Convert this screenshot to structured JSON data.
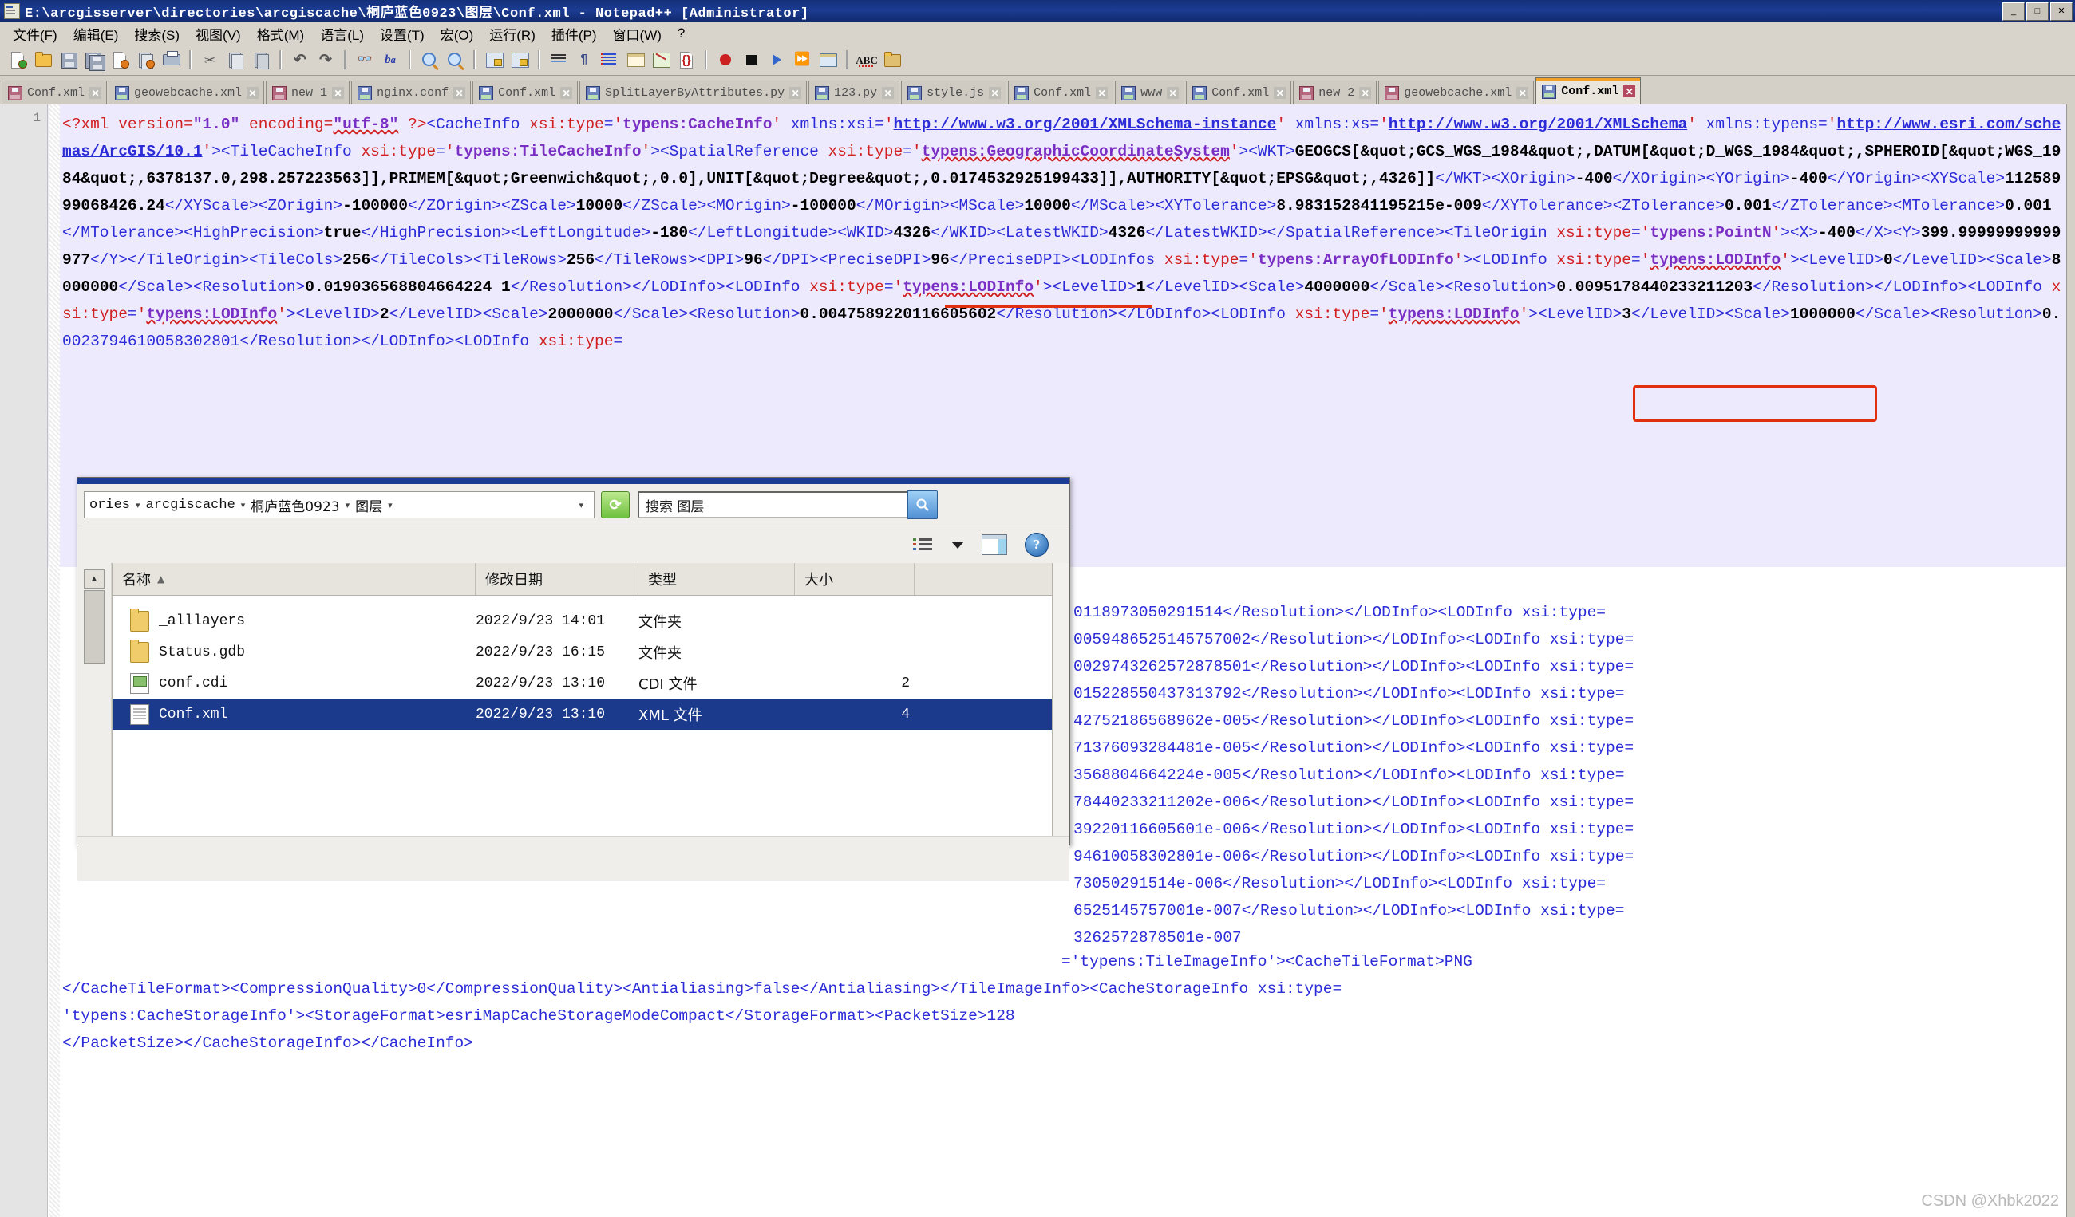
{
  "window": {
    "title": "E:\\arcgisserver\\directories\\arcgiscache\\桐庐蓝色0923\\图层\\Conf.xml - Notepad++ [Administrator]",
    "minimize_label": "_",
    "maximize_label": "□",
    "close_label": "✕"
  },
  "menu": {
    "items": [
      {
        "label": "文件(F)"
      },
      {
        "label": "编辑(E)"
      },
      {
        "label": "搜索(S)"
      },
      {
        "label": "视图(V)"
      },
      {
        "label": "格式(M)"
      },
      {
        "label": "语言(L)"
      },
      {
        "label": "设置(T)"
      },
      {
        "label": "宏(O)"
      },
      {
        "label": "运行(R)"
      },
      {
        "label": "插件(P)"
      },
      {
        "label": "窗口(W)"
      },
      {
        "label": "?"
      }
    ]
  },
  "toolbar": {
    "icons": [
      "new-file-icon",
      "open-file-icon",
      "save-icon",
      "save-all-icon",
      "close-file-icon",
      "close-all-icon",
      "print-icon",
      "cut-icon",
      "copy-icon",
      "paste-icon",
      "undo-icon",
      "redo-icon",
      "find-icon",
      "replace-icon",
      "zoom-in-icon",
      "zoom-out-icon",
      "sync-vertical-icon",
      "sync-horizontal-icon",
      "word-wrap-icon",
      "show-all-chars-icon",
      "indent-guide-icon",
      "ui-display-icon",
      "document-map-icon",
      "function-list-icon",
      "record-macro-icon",
      "stop-macro-icon",
      "play-macro-icon",
      "fast-play-macro-icon",
      "save-macro-icon",
      "spell-check-icon",
      "folder-workspace-icon"
    ]
  },
  "tabs": {
    "items": [
      {
        "label": "Conf.xml",
        "color": "red",
        "active": false
      },
      {
        "label": "geowebcache.xml",
        "color": "blue",
        "active": false
      },
      {
        "label": "new  1",
        "color": "red",
        "active": false
      },
      {
        "label": "nginx.conf",
        "color": "blue",
        "active": false
      },
      {
        "label": "Conf.xml",
        "color": "blue",
        "active": false
      },
      {
        "label": "SplitLayerByAttributes.py",
        "color": "blue",
        "active": false
      },
      {
        "label": "123.py",
        "color": "blue",
        "active": false
      },
      {
        "label": "style.js",
        "color": "blue",
        "active": false
      },
      {
        "label": "Conf.xml",
        "color": "blue",
        "active": false
      },
      {
        "label": "www",
        "color": "blue",
        "active": false
      },
      {
        "label": "Conf.xml",
        "color": "blue",
        "active": false
      },
      {
        "label": "new  2",
        "color": "red",
        "active": false
      },
      {
        "label": "geowebcache.xml",
        "color": "red",
        "active": false
      },
      {
        "label": "Conf.xml",
        "color": "blue",
        "active": true
      }
    ],
    "close_glyph": "✕"
  },
  "editor": {
    "line_number": "1",
    "xml_lines": [
      "<?xml version=\"1.0\" encoding=\"utf-8\" ?><CacheInfo xsi:type='typens:CacheInfo' xmlns:xsi='http://www.w3.org/2001/XMLSchema-instance' xmlns:xs='http://www.w3.org/2001/XMLSchema' xmlns:typens='http://www.esri.com/schemas/ArcGIS/10.1'><TileCacheInfo xsi:type='typens:TileCacheInfo'><SpatialReference xsi:type='typens:GeographicCoordinateSystem'><WKT>GEOGCS[&quot;GCS_WGS_1984&quot;,DATUM[&quot;D_WGS_1984&quot;,SPHEROID[&quot;WGS_1984&quot;,6378137.0,298.257223563]],PRIMEM[&quot;Greenwich&quot;,0.0],UNIT[&quot;Degree&quot;,0.0174532925199433]],AUTHORITY[&quot;EPSG&quot;,4326]]</WKT><XOrigin>-400</XOrigin><YOrigin>-400</YOrigin><XYScale>11258999068426.24</XYScale><ZOrigin>-100000</ZOrigin><ZScale>10000</ZScale><MOrigin>-100000</MOrigin><MScale>10000</MScale><XYTolerance>8.983152841195215e-009</XYTolerance><ZTolerance>0.001</ZTolerance><MTolerance>0.001</MTolerance><HighPrecision>true</HighPrecision><LeftLongitude>-180</LeftLongitude><WKID>4326</WKID><LatestWKID>4326</LatestWKID></SpatialReference><TileOrigin xsi:type='typens:PointN'><X>-400</X><Y>399.99999999999977</Y></TileOrigin><TileCols>256</TileCols><TileRows>256</TileRows><DPI>96</DPI><PreciseDPI>96</PreciseDPI><LODInfos xsi:type='typens:ArrayOfLODInfo'>"
    ],
    "visible_text_blocks": [
      "<?xml version=\"1.0\" encoding=\"utf-8\" ?><CacheInfo xsi:type='typens:CacheInfo' xmlns:xsi='http://www.w3.org/2001/XMLSchema-instance' xmlns:xs='",
      "http://www.w3.org/2001/XMLSchema' xmlns:typens='http://www.esri.com/schemas/ArcGIS/10.1'><TileCacheInfo xsi:type='typens:TileCacheInfo'",
      "><SpatialReference xsi:type='typens:GeographicCoordinateSystem'><WKT>GEOGCS[&quot;GCS_WGS_1984&quot;,DATUM[&quot;D_WGS_1984&quot;,SPHEROID[",
      "&quot;WGS_1984&quot;,6378137.0,298.257223563]],PRIMEM[&quot;Greenwich&quot;,0.0],UNIT[&quot;Degree&quot;,0.0174532925199433]],AUTHORITY[&quot;",
      "EPSG&quot;,4326]]</WKT><XOrigin>-400</XOrigin><YOrigin>-400</YOrigin><XYScale>11258999068426.24</XYScale><ZOrigin>-100000</ZOrigin><ZScale>10000",
      "</ZScale><MOrigin>-100000</MOrigin><MScale>10000</MScale><XYTolerance>8.983152841195215e-009</XYTolerance><ZTolerance>0.001",
      "</ZTolerance><MTolerance>0.001</MTolerance><HighPrecision>true</HighPrecision><LeftLongitude>-180</LeftLongitude><WKID>4326</WKID><LatestWKID>",
      "4326</LatestWKID></SpatialReference><TileOrigin xsi:type='typens:PointN'><X>-400</X><Y>399.99999999999977</Y></TileOrigin><TileCols>256",
      "</TileCols><TileRows>256</TileRows><DPI>96</DPI><PreciseDPI>96</PreciseDPI><LODInfos xsi:type='typens:ArrayOfLODInfo'><LODInfo xsi:type=",
      "'typens:LODInfo'><LevelID>0</LevelID><Scale>8000000</Scale><Resolution>0.019036568804664224 1</Resolution></LODInfo><LODInfo xsi:type=",
      "'typens:LODInfo'><LevelID>1</LevelID><Scale>4000000</Scale><Resolution>0.0095178440233211203</Resolution></LODInfo><LODInfo xsi:type=",
      "'typens:LODInfo'><LevelID>2</LevelID><Scale>2000000</Scale><Resolution>0.0047589220116605602</Resolution></LODInfo><LODInfo xsi:type=",
      "'typens:LODInfo'><LevelID>3</LevelID><Scale>1000000</Scale><Resolution>0.0023794610058302801</Resolution></LODInfo><LODInfo xsi:type="
    ],
    "right_fragments": [
      "0118973050291514</Resolution></LODInfo><LODInfo xsi:type=",
      "0059486525145757002</Resolution></LODInfo><LODInfo xsi:type=",
      "0029743262572878501</Resolution></LODInfo><LODInfo xsi:type=",
      "015228550437313792</Resolution></LODInfo><LODInfo xsi:type=",
      "42752186568962e-005</Resolution></LODInfo><LODInfo xsi:type=",
      "71376093284481e-005</Resolution></LODInfo><LODInfo xsi:type=",
      "3568804664224e-005</Resolution></LODInfo><LODInfo xsi:type=",
      "78440233211202e-006</Resolution></LODInfo><LODInfo xsi:type=",
      "39220116605601e-006</Resolution></LODInfo><LODInfo xsi:type=",
      "94610058302801e-006</Resolution></LODInfo><LODInfo xsi:type=",
      "73050291514e-006</Resolution></LODInfo><LODInfo xsi:type=",
      "6525145757001e-007</Resolution></LODInfo><LODInfo xsi:type=",
      "3262572878501e-007"
    ],
    "tail_lines": [
      "='typens:TileImageInfo'><CacheTileFormat>PNG",
      "</CacheTileFormat><CompressionQuality>0</CompressionQuality><Antialiasing>false</Antialiasing></TileImageInfo><CacheStorageInfo xsi:type=",
      "'typens:CacheStorageInfo'><StorageFormat>esriMapCacheStorageModeCompact</StorageFormat><PacketSize>128",
      "</PacketSize></CacheStorageInfo></CacheInfo>"
    ],
    "annotations": [
      {
        "name": "wkid-highlight-box",
        "text": "<WKID>4326</WKID>"
      },
      {
        "name": "gcs-wgs-1984-underline",
        "text": "GCS_WGS_1984"
      }
    ]
  },
  "file_dialog": {
    "breadcrumb": [
      {
        "label": "ories"
      },
      {
        "label": "arcgiscache"
      },
      {
        "label": "桐庐蓝色0923"
      },
      {
        "label": "图层"
      }
    ],
    "breadcrumb_separator": "▾",
    "dropdown_glyph": "▾",
    "refresh_label": "⟳",
    "search": {
      "placeholder": "搜索 图层",
      "value": "",
      "button_glyph": "🔍"
    },
    "view_controls": {
      "view_mode": "list-view-icon",
      "view_dropdown": "chevron-down-icon",
      "preview_pane": "preview-pane-icon",
      "help": "?"
    },
    "columns": [
      {
        "label": "名称",
        "sort": "▲"
      },
      {
        "label": "修改日期",
        "sort": ""
      },
      {
        "label": "类型",
        "sort": ""
      },
      {
        "label": "大小",
        "sort": ""
      }
    ],
    "rows": [
      {
        "icon": "folder-icon",
        "name": "_alllayers",
        "date": "2022/9/23 14:01",
        "type": "文件夹",
        "size": "",
        "selected": false
      },
      {
        "icon": "folder-icon",
        "name": "Status.gdb",
        "date": "2022/9/23 16:15",
        "type": "文件夹",
        "size": "",
        "selected": false
      },
      {
        "icon": "cdi-file-icon",
        "name": "conf.cdi",
        "date": "2022/9/23 13:10",
        "type": "CDI 文件",
        "size": "2",
        "selected": false
      },
      {
        "icon": "xml-file-icon",
        "name": "Conf.xml",
        "date": "2022/9/23 13:10",
        "type": "XML 文件",
        "size": "4",
        "selected": true
      }
    ],
    "scroll_up_glyph": "▲"
  },
  "watermark": {
    "text": "CSDN @Xhbk2022"
  },
  "colors": {
    "title_bar": "#1b3c92",
    "menu_bg": "#d8d4cc",
    "xml_tag": "#2b2bd8",
    "xml_attr": "#d02020",
    "xml_value": "#7a2fc4",
    "selection": "#1b3a8c",
    "active_tab_accent": "#f0a024",
    "annotation_red": "#e03010",
    "code_bg": "#eeeafd"
  }
}
